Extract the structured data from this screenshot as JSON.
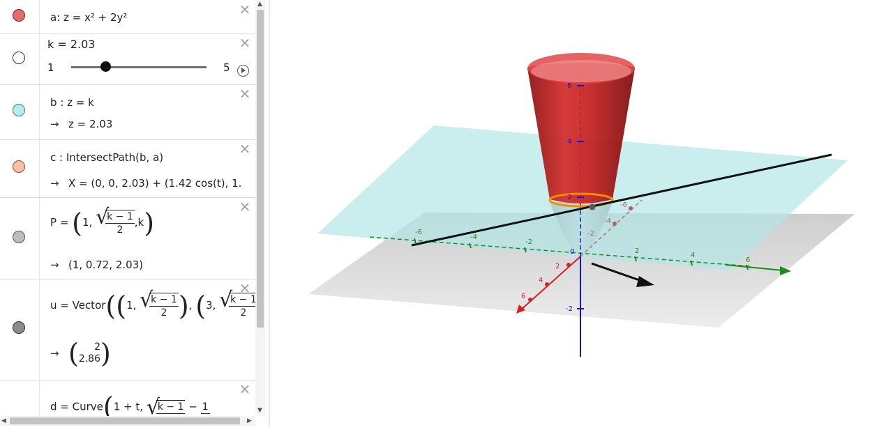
{
  "algebra": {
    "a": {
      "text": "a: z = x² + 2y²",
      "color": "#e26b6b"
    },
    "k": {
      "text": "k = 2.03",
      "min": "1",
      "max": "5",
      "value": 2.03,
      "slider_min": 1,
      "slider_max": 5
    },
    "b": {
      "def": "b : z = k",
      "result": "z = 2.03",
      "color": "#b4ecec"
    },
    "c": {
      "def": "c : IntersectPath(b, a)",
      "result": "X = (0, 0, 2.03) + (1.42 cos(t), 1.",
      "color": "#f7c0a6"
    },
    "P": {
      "lhs": "P =",
      "first": "1,",
      "num": "k − 1",
      "den": "2",
      "last": ",k",
      "result": "(1, 0.72, 2.03)",
      "color": "#bdbdbd"
    },
    "u": {
      "lhs": "u = Vector",
      "first": "1,",
      "num": "k − 1",
      "den": "2",
      "second": "3,",
      "num2": "k − 1",
      "den2": "2",
      "v_top": "2",
      "v_bot": "2.86",
      "color": "#8c8c8c"
    },
    "d": {
      "lhs": "d = Curve",
      "start": "1 + t,",
      "num": "k − 1",
      "minus": "−",
      "onum": "1"
    },
    "arrow": "→",
    "close": "×"
  },
  "axis_ticks": {
    "x": [
      "2",
      "4",
      "6"
    ],
    "y": [
      "-6",
      "-4",
      "-2",
      "2",
      "4",
      "6"
    ],
    "z": [
      "6",
      "4",
      "2",
      "0",
      "-2"
    ],
    "y2": [
      "-6",
      "-4",
      "-2"
    ]
  },
  "colors": {
    "x_axis": "#d42020",
    "y_axis": "#1f8a1f",
    "z_axis": "#1414c8",
    "surface": "#c41e1e",
    "plane": "#b4e6e6",
    "intersection": "#ff8800"
  }
}
